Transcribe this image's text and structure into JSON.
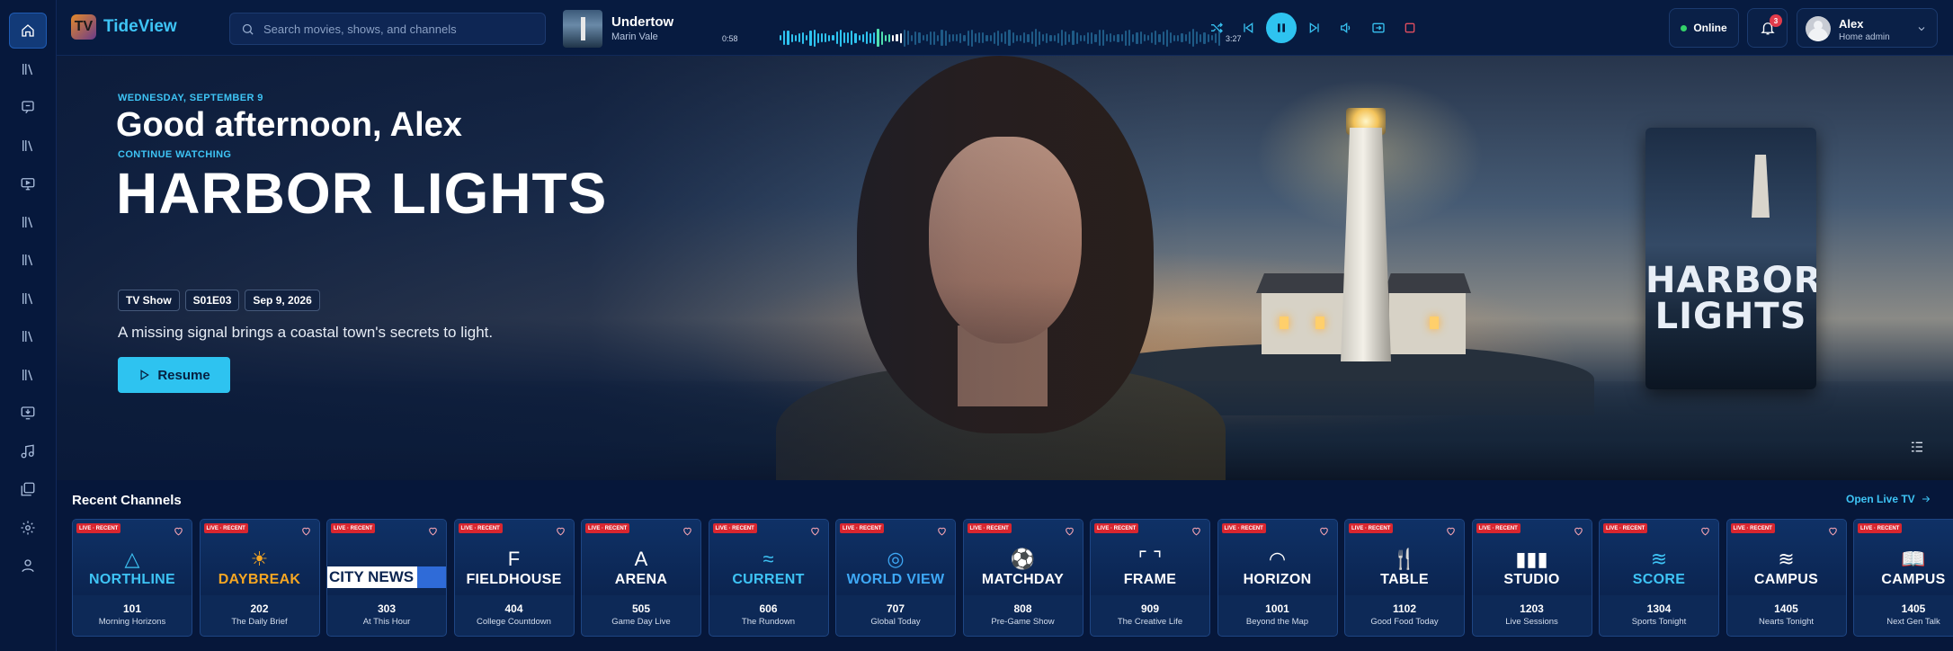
{
  "app": {
    "name": "TideView",
    "logo_mark": "TV"
  },
  "search": {
    "placeholder": "Search movies, shows, and channels"
  },
  "sidebar": {
    "items": [
      {
        "name": "home",
        "icon": "home-icon"
      },
      {
        "name": "library",
        "icon": "library-icon"
      },
      {
        "name": "messages",
        "icon": "chat-icon"
      },
      {
        "name": "library-2",
        "icon": "library-icon"
      },
      {
        "name": "live-tv",
        "icon": "tv-icon"
      },
      {
        "name": "library-3",
        "icon": "library-icon"
      },
      {
        "name": "library-4",
        "icon": "library-icon"
      },
      {
        "name": "library-5",
        "icon": "library-icon"
      },
      {
        "name": "library-6",
        "icon": "library-icon"
      },
      {
        "name": "library-7",
        "icon": "library-icon"
      },
      {
        "name": "recordings",
        "icon": "monitor-download-icon"
      },
      {
        "name": "music",
        "icon": "music-icon"
      },
      {
        "name": "collections",
        "icon": "collection-icon"
      },
      {
        "name": "settings",
        "icon": "gear-icon"
      },
      {
        "name": "profile",
        "icon": "user-icon"
      }
    ]
  },
  "now_playing": {
    "title": "Undertow",
    "artist": "Marin Vale",
    "elapsed": "0:58",
    "duration": "3:27",
    "progress": 0.28
  },
  "status": {
    "label": "Online",
    "color": "#34d36a"
  },
  "notifications": {
    "count": "3"
  },
  "user": {
    "name": "Alex",
    "role": "Home admin"
  },
  "hero": {
    "date": "WEDNESDAY, SEPTEMBER 9",
    "greeting": "Good afternoon, Alex",
    "section": "CONTINUE WATCHING",
    "title": "HARBOR LIGHTS",
    "chips": [
      "TV Show",
      "S01E03",
      "Sep 9, 2026"
    ],
    "description": "A missing signal brings a coastal town's secrets to light.",
    "resume_label": "Resume",
    "poster_title": "HARBOR LIGHTS"
  },
  "recent": {
    "title": "Recent Channels",
    "open_live": "Open Live TV",
    "live_tag": "LIVE · RECENT",
    "channels": [
      {
        "name": "NORTHLINE",
        "icon": "△",
        "color": "#3ec4f5",
        "number": "101",
        "show": "Morning Horizons"
      },
      {
        "name": "DAYBREAK",
        "icon": "☀",
        "color": "#f5a623",
        "number": "202",
        "show": "The Daily Brief"
      },
      {
        "name": "CITY NEWS",
        "icon": "",
        "color": "#2f6bd8",
        "number": "303",
        "show": "At This Hour"
      },
      {
        "name": "FIELDHOUSE",
        "icon": "F",
        "color": "#ffffff",
        "number": "404",
        "show": "College Countdown"
      },
      {
        "name": "ARENA",
        "icon": "A",
        "color": "#ffffff",
        "number": "505",
        "show": "Game Day Live"
      },
      {
        "name": "CURRENT",
        "icon": "≈",
        "color": "#3ec4f5",
        "number": "606",
        "show": "The Rundown"
      },
      {
        "name": "WORLD VIEW",
        "icon": "◎",
        "color": "#3ea8f5",
        "number": "707",
        "show": "Global Today"
      },
      {
        "name": "MATCHDAY",
        "icon": "⚽",
        "color": "#ffffff",
        "number": "808",
        "show": "Pre-Game Show"
      },
      {
        "name": "FRAME",
        "icon": "⌜ ⌝",
        "color": "#ffffff",
        "number": "909",
        "show": "The Creative Life"
      },
      {
        "name": "HORIZON",
        "icon": "◠",
        "color": "#ffffff",
        "number": "1001",
        "show": "Beyond the Map"
      },
      {
        "name": "TABLE",
        "icon": "🍴",
        "color": "#ffffff",
        "number": "1102",
        "show": "Good Food Today"
      },
      {
        "name": "STUDIO",
        "icon": "▮▮▮",
        "color": "#ffffff",
        "number": "1203",
        "show": "Live Sessions"
      },
      {
        "name": "SCORE",
        "icon": "≋",
        "color": "#3ec4f5",
        "number": "1304",
        "show": "Sports Tonight"
      },
      {
        "name": "CAMPUS",
        "icon": "≋",
        "color": "#ffffff",
        "number": "1405",
        "show": "Nearts Tonight"
      },
      {
        "name": "CAMPUS",
        "icon": "📖",
        "color": "#ffffff",
        "number": "1405",
        "show": "Next Gen Talk"
      }
    ]
  },
  "colors": {
    "accent": "#2ec3f0",
    "live": "#d9262f",
    "background": "#06173a"
  }
}
